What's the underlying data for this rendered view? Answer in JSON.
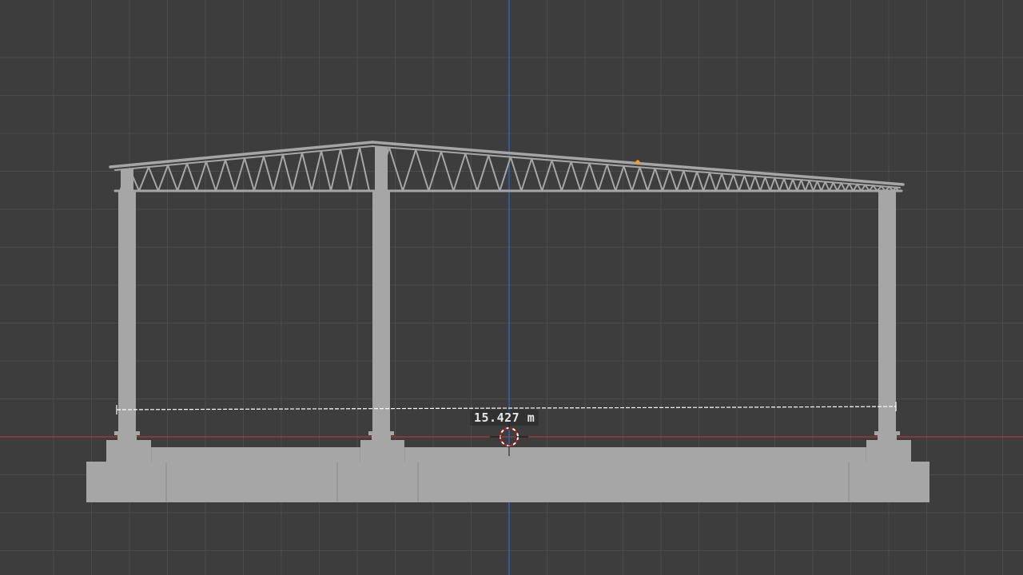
{
  "viewport": {
    "background": "#3d3d3d",
    "grid_color": "#4b4b4b",
    "x_axis_color": "#b03a3a",
    "z_axis_color": "#2f68c2",
    "model_color": "#a6a6a6",
    "selection_color": "#ff9a1a"
  },
  "measurement": {
    "label": "15.427 m",
    "value": 15.427,
    "unit": "m"
  },
  "cursor": {
    "type": "3d-cursor-icon"
  }
}
